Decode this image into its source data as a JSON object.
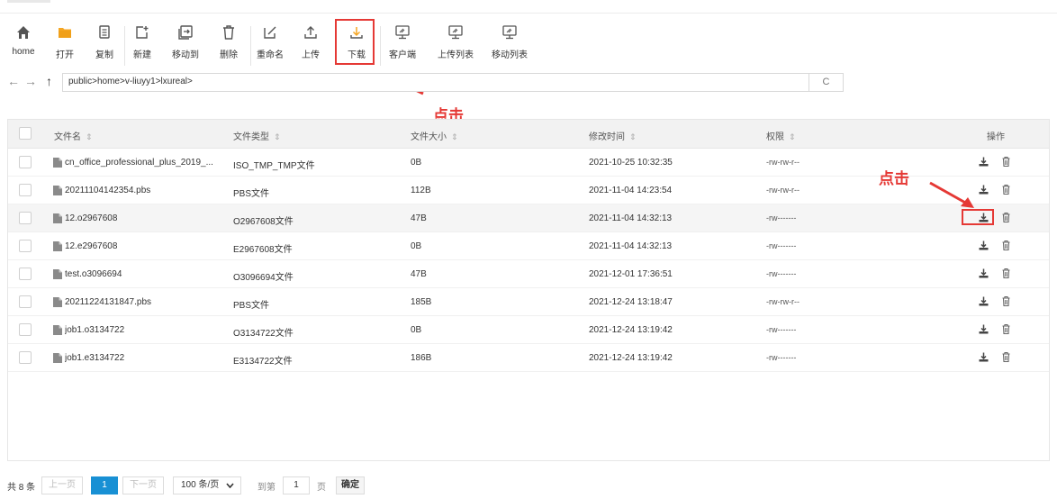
{
  "toolbar": {
    "items": [
      {
        "label": "home",
        "icon": "home-icon"
      },
      {
        "label": "打开",
        "icon": "folder-icon"
      },
      {
        "label": "复制",
        "icon": "copy-icon"
      },
      {
        "label": "新建",
        "icon": "new-file-icon"
      },
      {
        "label": "移动到",
        "icon": "move-icon"
      },
      {
        "label": "删除",
        "icon": "trash-icon"
      },
      {
        "label": "重命名",
        "icon": "rename-icon"
      },
      {
        "label": "上传",
        "icon": "upload-icon"
      },
      {
        "label": "下载",
        "icon": "download-icon"
      },
      {
        "label": "客户端",
        "icon": "monitor-icon"
      },
      {
        "label": "上传列表",
        "icon": "monitor-icon"
      },
      {
        "label": "移动列表",
        "icon": "monitor-icon"
      }
    ]
  },
  "path": {
    "back": "←",
    "forward": "→",
    "up": "↑",
    "value": "public>home>v-liuyy1>lxureal>",
    "refresh": "C"
  },
  "annotations": {
    "click_toolbar": "点击",
    "click_row": "点击"
  },
  "table": {
    "headers": {
      "name": "文件名",
      "type": "文件类型",
      "size": "文件大小",
      "mtime": "修改时间",
      "perm": "权限",
      "ops": "操作"
    },
    "rows": [
      {
        "name": "cn_office_professional_plus_2019_...",
        "type": "ISO_TMP_TMP文件",
        "size": "0B",
        "mtime": "2021-10-25 10:32:35",
        "perm": "-rw-rw-r--"
      },
      {
        "name": "20211104142354.pbs",
        "type": "PBS文件",
        "size": "112B",
        "mtime": "2021-11-04 14:23:54",
        "perm": "-rw-rw-r--"
      },
      {
        "name": "12.o2967608",
        "type": "O2967608文件",
        "size": "47B",
        "mtime": "2021-11-04 14:32:13",
        "perm": "-rw-------"
      },
      {
        "name": "12.e2967608",
        "type": "E2967608文件",
        "size": "0B",
        "mtime": "2021-11-04 14:32:13",
        "perm": "-rw-------"
      },
      {
        "name": "test.o3096694",
        "type": "O3096694文件",
        "size": "47B",
        "mtime": "2021-12-01 17:36:51",
        "perm": "-rw-------"
      },
      {
        "name": "20211224131847.pbs",
        "type": "PBS文件",
        "size": "185B",
        "mtime": "2021-12-24 13:18:47",
        "perm": "-rw-rw-r--"
      },
      {
        "name": "job1.o3134722",
        "type": "O3134722文件",
        "size": "0B",
        "mtime": "2021-12-24 13:19:42",
        "perm": "-rw-------"
      },
      {
        "name": "job1.e3134722",
        "type": "E3134722文件",
        "size": "186B",
        "mtime": "2021-12-24 13:19:42",
        "perm": "-rw-------"
      }
    ]
  },
  "pager": {
    "total": "共 8 条",
    "prev": "上一页",
    "current": "1",
    "next": "下一页",
    "per_page": "100 条/页",
    "goto_label": "到第",
    "goto_value": "1",
    "page_suffix": "页",
    "confirm": "确定"
  },
  "colors": {
    "accent": "#1890d4",
    "highlight": "#e53935",
    "folder": "#f5a623"
  }
}
